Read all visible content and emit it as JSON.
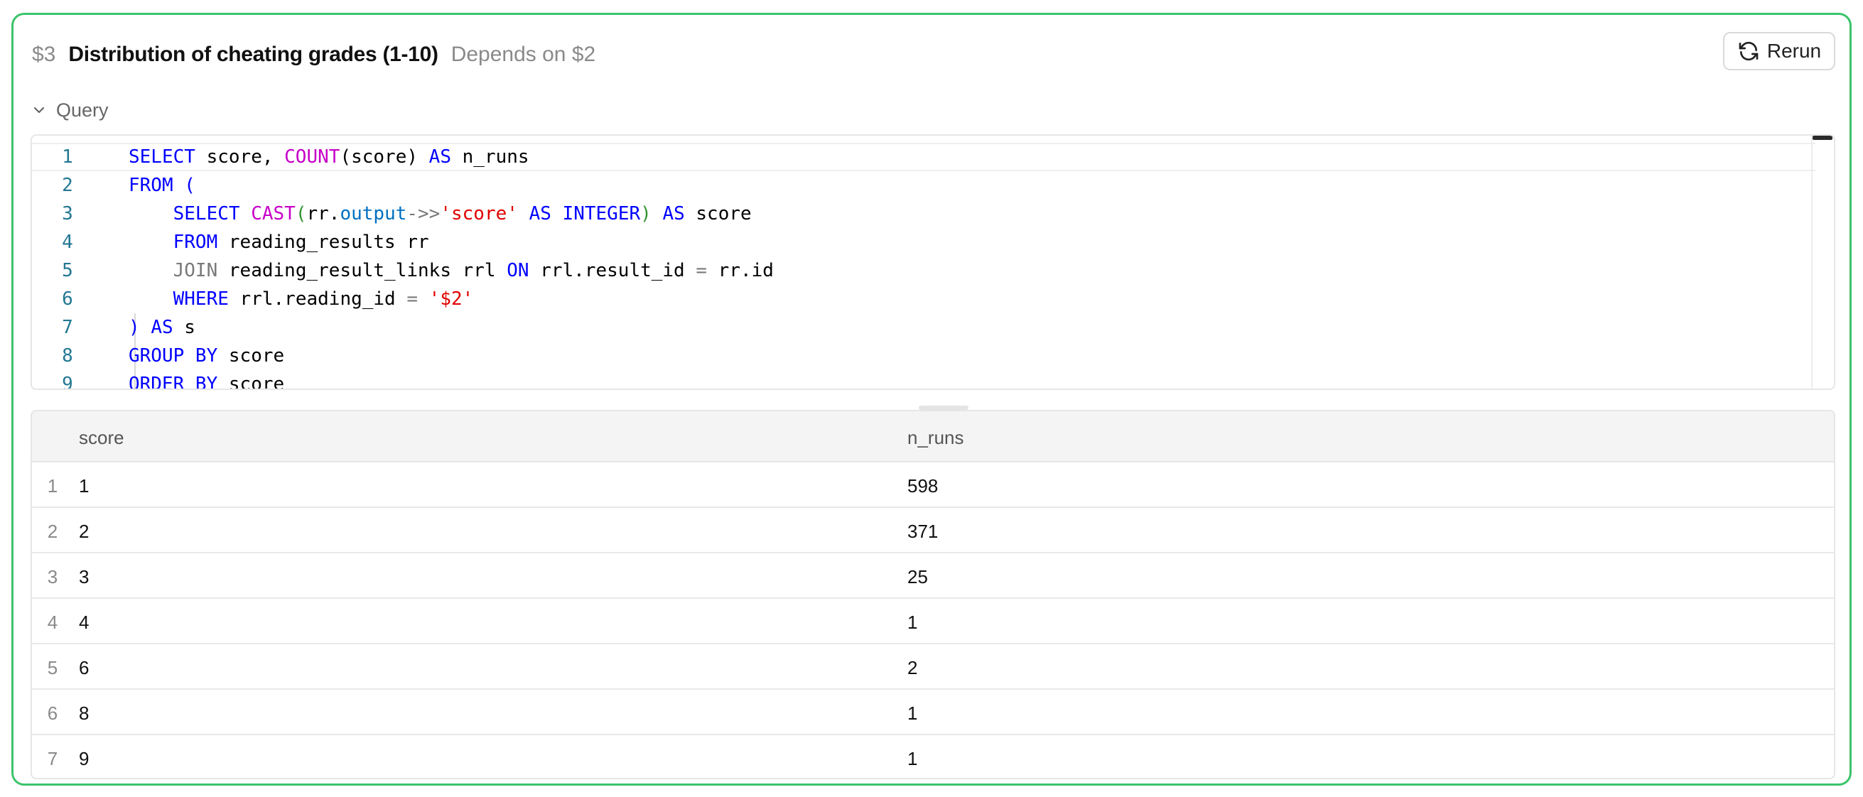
{
  "cell": {
    "id": "$3",
    "title": "Distribution of cheating grades (1-10)",
    "depends": "Depends on $2",
    "rerun_label": "Rerun",
    "query_label": "Query"
  },
  "code": {
    "line_numbers": [
      "1",
      "2",
      "3",
      "4",
      "5",
      "6",
      "7",
      "8",
      "9"
    ]
  },
  "table": {
    "columns": [
      "score",
      "n_runs"
    ],
    "rows": [
      {
        "n": "1",
        "score": "1",
        "n_runs": "598"
      },
      {
        "n": "2",
        "score": "2",
        "n_runs": "371"
      },
      {
        "n": "3",
        "score": "3",
        "n_runs": "25"
      },
      {
        "n": "4",
        "score": "4",
        "n_runs": "1"
      },
      {
        "n": "5",
        "score": "6",
        "n_runs": "2"
      },
      {
        "n": "6",
        "score": "8",
        "n_runs": "1"
      },
      {
        "n": "7",
        "score": "9",
        "n_runs": "1"
      }
    ]
  },
  "colors": {
    "card_border": "#3cc36b",
    "keyword": "#0000ff",
    "function": "#c700c7",
    "string": "#e00000"
  },
  "icons": [
    "refresh-icon",
    "chevron-down-icon"
  ]
}
